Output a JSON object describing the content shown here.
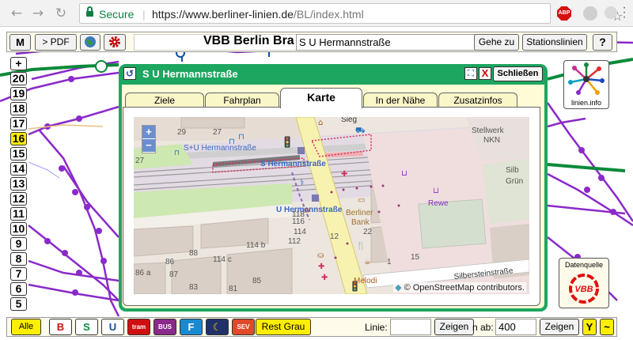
{
  "browser": {
    "secure_label": "Secure",
    "url_domain": "https://www.berliner-linien.de",
    "url_path": "/BL/index.html"
  },
  "toolbar": {
    "m_label": "M",
    "pdf_label": "> PDF",
    "title": "VBB Berlin Bra",
    "stop_value": "S U Hermannstraße",
    "goto_label": "Gehe zu",
    "lines_label": "Stationslinien",
    "help_label": "?"
  },
  "zoom_levels": [
    "+",
    "20",
    "19",
    "18",
    "17",
    "16",
    "15",
    "14",
    "13",
    "12",
    "11",
    "10",
    "9",
    "8",
    "7",
    "6",
    "5"
  ],
  "active_zoom": "16",
  "logo": {
    "text": "linien.info"
  },
  "datenquelle": {
    "label": "Datenquelle",
    "brand": "VBB"
  },
  "dialog": {
    "title": "S U Hermannstraße",
    "close_label": "Schließen",
    "x_label": "X",
    "tabs": [
      "Ziele",
      "Fahrplan",
      "Karte",
      "In der Nähe",
      "Zusatzinfos"
    ],
    "active_tab": "Karte"
  },
  "map": {
    "labels": {
      "station_sbahn": "S+U Hermannstraße",
      "s_hermann": "S Hermannstraße",
      "u_hermann": "U Hermannstraße",
      "stellwerk": "Stellwerk",
      "nkn": "NKN",
      "rewe": "Rewe",
      "bank1": "Berliner",
      "bank2": "Bank",
      "silbersteinstr": "Silbersteinstraße",
      "silb": "Silb",
      "grun": "Grün",
      "melodi": "Melodi",
      "sieg": "Sieg",
      "n29": "29",
      "n27": "27",
      "n118": "118",
      "n116": "116",
      "n114": "114",
      "n114b": "114 b",
      "n114c": "114 c",
      "n86a": "86 a",
      "n86": "86",
      "n88": "88",
      "n87": "87",
      "n83": "83",
      "n85": "85",
      "n81": "81",
      "n12": "12",
      "n22": "22",
      "n15": "15",
      "n1": "1",
      "n27b": "27",
      "n112": "112"
    },
    "zoom_in": "+",
    "zoom_out": "−",
    "attribution": "© OpenStreetMap contributors."
  },
  "bottombar": {
    "all_label": "Alle",
    "filters": [
      {
        "label": "B",
        "bg": "#ffffff",
        "color": "#d01010"
      },
      {
        "label": "S",
        "bg": "#ffffff",
        "color": "#0a8a3a"
      },
      {
        "label": "U",
        "bg": "#ffffff",
        "color": "#1050a0"
      },
      {
        "label": "tram",
        "bg": "#d01010",
        "color": "#ffffff"
      },
      {
        "label": "BUS",
        "bg": "#8a2a8a",
        "color": "#ffffff"
      },
      {
        "label": "F",
        "bg": "#1a8ad0",
        "color": "#ffffff"
      },
      {
        "label": "☾",
        "bg": "#20306a",
        "color": "#ffcc00"
      },
      {
        "label": "SEV",
        "bg": "#e04a2a",
        "color": "#ffffff"
      }
    ],
    "rest_label": "Rest Grau",
    "line_label": "Linie:",
    "line_value": "",
    "show_label": "Zeigen",
    "ab_label": "n ab:",
    "ab_value": "400",
    "show2_label": "Zeigen",
    "y_label": "Y",
    "tilde_label": "~"
  },
  "colors": {
    "dialog_green": "#1da660",
    "s_bahn_green": "#0a8a3a",
    "line_violet": "#8a2ac8",
    "highlight_yellow": "#ffee00"
  }
}
